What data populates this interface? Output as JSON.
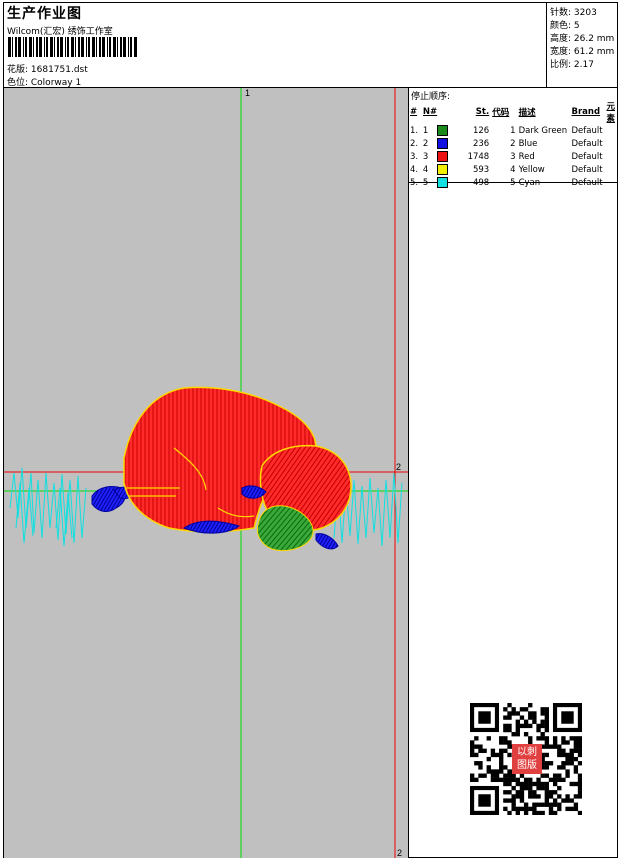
{
  "header": {
    "title": "生产作业图",
    "studio": "Wilcom(汇宏) 绣饰工作室",
    "design_label": "花版: 1681751.dst",
    "colorway_label": "色位: Colorway 1"
  },
  "stats": {
    "stitches": "针数: 3203",
    "colors": "颜色: 5",
    "height": "高度: 26.2 mm",
    "width": "宽度: 61.2 mm",
    "scale": "比例: 2.17"
  },
  "canvas": {
    "axis_label_top": "1",
    "axis_label_right": "2",
    "axis_label_bottom": "2"
  },
  "stop_sequence": {
    "title": "停止顺序:",
    "headers": [
      "#",
      "N#",
      "St.",
      "代码",
      "描述",
      "Brand",
      "元素"
    ],
    "rows": [
      {
        "idx": "1.",
        "n": "1",
        "color": "#1a8a1a",
        "st": "126",
        "code": "1",
        "desc": "Dark Green",
        "brand": "Default"
      },
      {
        "idx": "2.",
        "n": "2",
        "color": "#1010e0",
        "st": "236",
        "code": "2",
        "desc": "Blue",
        "brand": "Default"
      },
      {
        "idx": "3.",
        "n": "3",
        "color": "#ee1111",
        "st": "1748",
        "code": "3",
        "desc": "Red",
        "brand": "Default"
      },
      {
        "idx": "4.",
        "n": "4",
        "color": "#f0f000",
        "st": "593",
        "code": "4",
        "desc": "Yellow",
        "brand": "Default"
      },
      {
        "idx": "5.",
        "n": "5",
        "color": "#10e0e0",
        "st": "498",
        "code": "5",
        "desc": "Cyan",
        "brand": "Default"
      }
    ]
  },
  "qr": {
    "seal_text_line1": "以刺",
    "seal_text_line2": "图版"
  }
}
